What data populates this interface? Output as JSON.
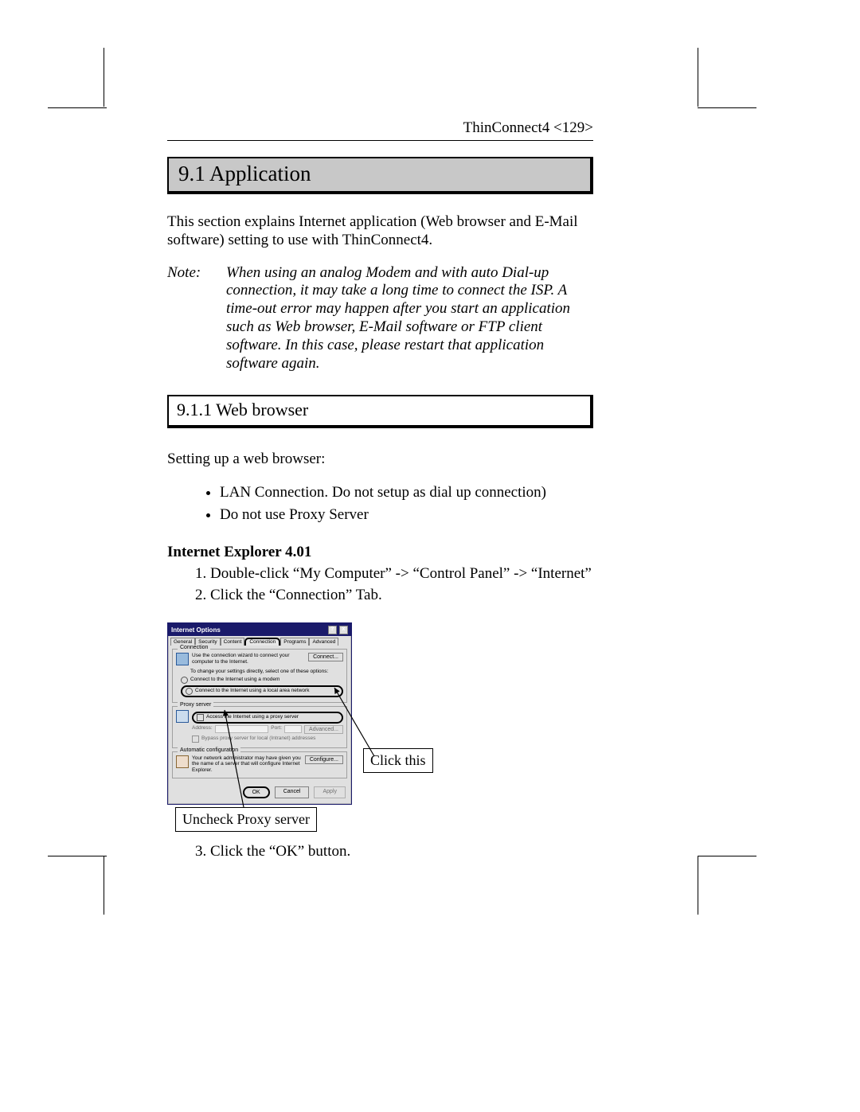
{
  "header": "ThinConnect4 <129>",
  "section_title": "9.1 Application",
  "intro": "This section explains Internet application (Web browser and E-Mail software) setting to use with ThinConnect4.",
  "note_label": "Note:",
  "note_body": "When using an analog Modem and with auto Dial-up connection, it may take a long time to connect the ISP. A time-out error may happen after you start an application such as Web browser, E-Mail software or FTP client software. In this case, please restart that application software again.",
  "subsection_title": "9.1.1 Web browser",
  "setup_intro": "Setting up a web browser:",
  "bullets": [
    "LAN Connection. Do not setup as dial up connection)",
    "Do not use Proxy Server"
  ],
  "ie_heading": "Internet Explorer 4.01",
  "ordered_before": [
    "Double-click “My Computer” -> “Control Panel” -> “Internet”",
    "Click the “Connection” Tab."
  ],
  "ordered_after_start": 3,
  "ordered_after": [
    "Click the “OK” button."
  ],
  "callouts": {
    "top": "Click this",
    "bottom": "Uncheck Proxy server"
  },
  "dialog": {
    "title": "Internet Options",
    "tabs": [
      "General",
      "Security",
      "Content",
      "Connection",
      "Programs",
      "Advanced"
    ],
    "active_tab_index": 3,
    "groups": {
      "connection": {
        "label": "Connection",
        "desc": "Use the connection wizard to connect your computer to the Internet.",
        "button": "Connect...",
        "options_intro": "To change your settings directly, select one of these options:",
        "opt1": "Connect to the Internet using a modem",
        "opt2": "Connect to the Internet using a local area network"
      },
      "proxy": {
        "label": "Proxy server",
        "check": "Access the Internet using a proxy server",
        "port": "Port:",
        "addr": "Address:",
        "adv": "Advanced...",
        "bypass": "Bypass proxy server for local (Intranet) addresses"
      },
      "autoconf": {
        "label": "Automatic configuration",
        "desc": "Your network administrator may have given you the name of a server that will configure Internet Explorer.",
        "button": "Configure..."
      }
    },
    "buttons": {
      "ok": "OK",
      "cancel": "Cancel",
      "apply": "Apply"
    }
  }
}
